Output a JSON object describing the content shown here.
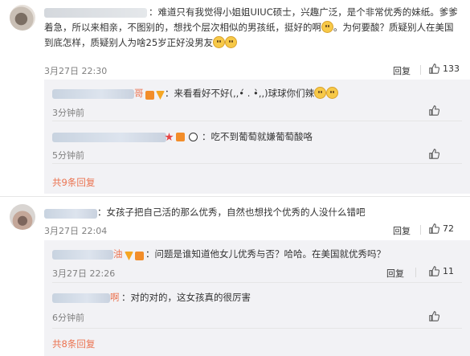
{
  "comments": [
    {
      "text": "：难道只有我觉得小姐姐UIUC硕士，兴趣广泛，是个非常优秀的妹纸。爹爹着急，所以来相亲，不图别的，想找个层次相似的男孩纸，挺好的啊",
      "text_tail": "。为何要酸？质疑别人在美国到底怎样，质疑别人为啥25岁正好没男友",
      "time": "3月27日 22:30",
      "reply_label": "回复",
      "likes": "133",
      "replies": [
        {
          "name_tail": "哥",
          "text": "：来看看好不好(,,•́ . •̀,,)球球你们辣",
          "time": "3分钟前",
          "likes": ""
        },
        {
          "name_tail": "",
          "text": "：吃不到葡萄就嫌葡萄酸咯",
          "time": "5分钟前",
          "likes": ""
        }
      ],
      "more": "共9条回复"
    },
    {
      "text": "：女孩子把自己活的那么优秀，自然也想找个优秀的人没什么错吧",
      "time": "3月27日 22:04",
      "reply_label": "回复",
      "likes": "72",
      "replies": [
        {
          "name_tail": "油",
          "text": "：问题是谁知道他女儿优秀与否？哈哈。在美国就优秀吗？",
          "time": "3月27日 22:26",
          "likes": "11"
        },
        {
          "name_tail": "啊",
          "text": "：对的对的，这女孩真的很厉害",
          "time": "6分钟前",
          "likes": ""
        }
      ],
      "more": "共8条回复"
    }
  ],
  "icons": {
    "like": "thumbs-up-icon",
    "smile": "smile-emoji-icon",
    "cry": "crying-emoji-icon"
  },
  "colors": {
    "accent": "#eb7350",
    "reply_bg": "#f2f2f5"
  }
}
